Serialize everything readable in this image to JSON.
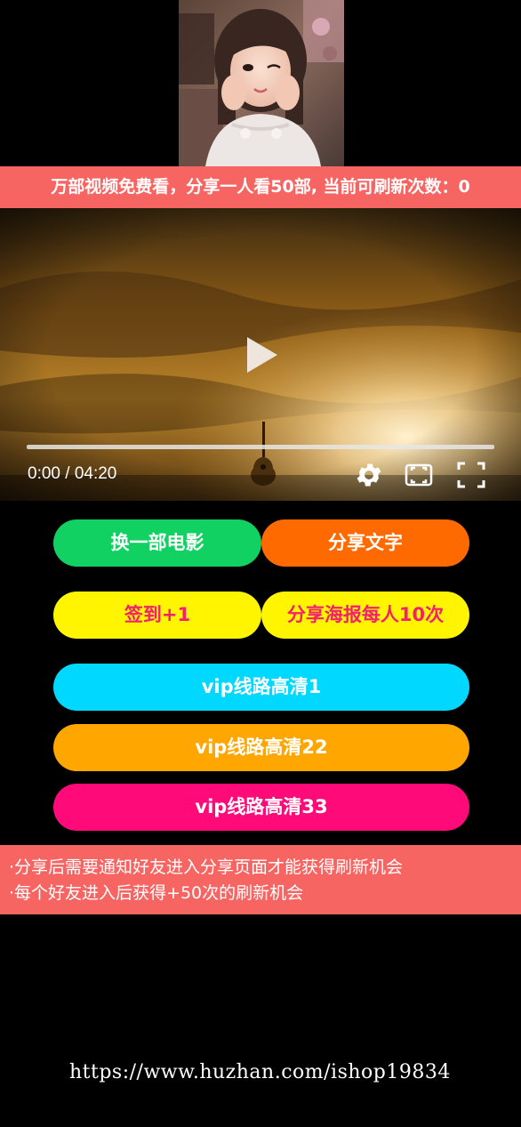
{
  "header": {
    "banner_text": "万部视频免费看，分享一人看50部, 当前可刷新次数：0"
  },
  "player": {
    "current_time": "0:00",
    "separator": " / ",
    "duration": "04:20",
    "progress_fraction": 0
  },
  "actions": {
    "change_movie": "换一部电影",
    "share_text": "分享文字",
    "checkin": "签到+1",
    "share_poster": "分享海报每人10次",
    "vip_1": "vip线路高清1",
    "vip_22": "vip线路高清22",
    "vip_33": "vip线路高清33"
  },
  "notes": {
    "line1": "·分享后需要通知好友进入分享页面才能获得刷新机会",
    "line2": "·每个好友进入后获得+50次的刷新机会"
  },
  "watermark": {
    "url": "https://www.huzhan.com/ishop19834"
  },
  "colors": {
    "accent_red": "#f76563",
    "green": "#12d163",
    "orange": "#ff6a00",
    "yellow": "#fff500",
    "pink_text": "#f2206e",
    "cyan": "#00d8ff",
    "amber": "#ffa600",
    "magenta": "#ff0a78"
  }
}
